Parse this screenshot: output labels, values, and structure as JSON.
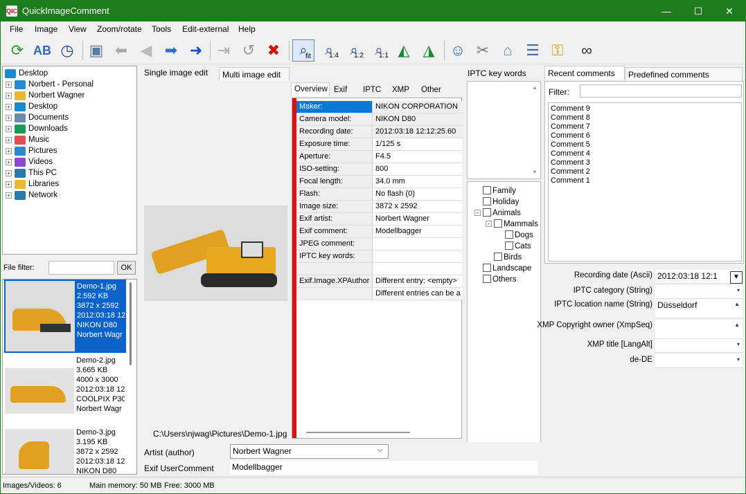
{
  "app": {
    "title": "QuickImageComment",
    "icon_text": "QIC"
  },
  "window_controls": {
    "minimize": "—",
    "maximize": "☐",
    "close": "✕"
  },
  "menu": [
    "File",
    "Image",
    "View",
    "Zoom/rotate",
    "Tools",
    "Edit-external",
    "Help"
  ],
  "toolbar": {
    "zoom_fit": "fit",
    "zoom_14": "1:4",
    "zoom_12": "1:2",
    "zoom_11": "1:1"
  },
  "folder_tree": {
    "root": "Desktop",
    "items": [
      "Norbert - Personal",
      "Norbert Wagner",
      "Desktop",
      "Documents",
      "Downloads",
      "Music",
      "Pictures",
      "Videos",
      "This PC",
      "Libraries",
      "Network"
    ]
  },
  "file_filter": {
    "label": "File filter:",
    "ok": "OK"
  },
  "thumbnails": [
    {
      "lines": [
        "Demo-1.jpg",
        "2.592 KB",
        "3872 x 2592",
        "2012:03:18 12",
        "NIKON D80",
        "Norbert Wagr"
      ]
    },
    {
      "lines": [
        "Demo-2.jpg",
        "3.665 KB",
        "4000 x 3000",
        "2012:03:18 12",
        "COOLPIX P300",
        "Norbert Wagr"
      ]
    },
    {
      "lines": [
        "Demo-3.jpg",
        "3.195 KB",
        "3872 x 2592",
        "2012:03:18 12",
        "NIKON D80"
      ]
    }
  ],
  "edit_tabs": {
    "single": "Single image edit",
    "multi": "Multi image edit"
  },
  "image_path": "C:\\Users\\njwag\\Pictures\\Demo-1.jpg",
  "meta_tabs": [
    "Overview",
    "Exif",
    "IPTC",
    "XMP",
    "Other"
  ],
  "overview": [
    {
      "k": "Maker:",
      "v": "NIKON CORPORATION"
    },
    {
      "k": "Camera model:",
      "v": "NIKON D80"
    },
    {
      "k": "Recording date:",
      "v": "2012:03:18 12:12:25.60"
    },
    {
      "k": "Exposure time:",
      "v": "1/125 s"
    },
    {
      "k": "Aperture:",
      "v": "F4.5"
    },
    {
      "k": "ISO-setting:",
      "v": "800"
    },
    {
      "k": "Focal length:",
      "v": "34.0 mm"
    },
    {
      "k": "Flash:",
      "v": "No flash (0)"
    },
    {
      "k": "Image size:",
      "v": "3872 x 2592"
    },
    {
      "k": "Exif artist:",
      "v": "Norbert Wagner"
    },
    {
      "k": "Exif comment:",
      "v": "Modellbagger"
    },
    {
      "k": "JPEG comment:",
      "v": ""
    },
    {
      "k": "IPTC key words:",
      "v": ""
    },
    {
      "k": "",
      "v": ""
    },
    {
      "k": "Exif.Image.XPAuthor",
      "v": "Different entry: <empty>"
    },
    {
      "k": "",
      "v": "Different entries can be a"
    }
  ],
  "iptc_keywords": {
    "title": "IPTC key words"
  },
  "keyword_tree": [
    {
      "label": "Family",
      "level": 0
    },
    {
      "label": "Holiday",
      "level": 0
    },
    {
      "label": "Animals",
      "level": 0
    },
    {
      "label": "Mammals",
      "level": 1
    },
    {
      "label": "Dogs",
      "level": 2
    },
    {
      "label": "Cats",
      "level": 2
    },
    {
      "label": "Birds",
      "level": 1
    },
    {
      "label": "Landscape",
      "level": 0
    },
    {
      "label": "Others",
      "level": 0
    }
  ],
  "comment_tabs": {
    "recent": "Recent comments",
    "predefined": "Predefined comments"
  },
  "comment_filter": {
    "label": "Filter:"
  },
  "comments": [
    "Comment 9",
    "Comment 8",
    "Comment 7",
    "Comment 6",
    "Comment 5",
    "Comment 4",
    "Comment 3",
    "Comment 2",
    "Comment 1"
  ],
  "properties": [
    {
      "label": "Recording date (Ascii)",
      "value": "2012:03:18 12:1"
    },
    {
      "label": "IPTC category (String)",
      "value": ""
    },
    {
      "label": "IPTC location name (String)",
      "value": "Düsseldorf"
    },
    {
      "label": "XMP Copyright owner (XmpSeq)",
      "value": ""
    },
    {
      "label": "XMP title [LangAlt]",
      "value": ""
    },
    {
      "label": "de-DE",
      "value": ""
    }
  ],
  "bottom_fields": {
    "artist_label": "Artist (author)",
    "artist_value": "Norbert Wagner",
    "comment_label": "Exif UserComment",
    "comment_value": "Modellbagger"
  },
  "status": {
    "images": "Images/Videos: 6",
    "memory": "Main memory: 50 MB",
    "free": "Free: 3000 MB"
  }
}
